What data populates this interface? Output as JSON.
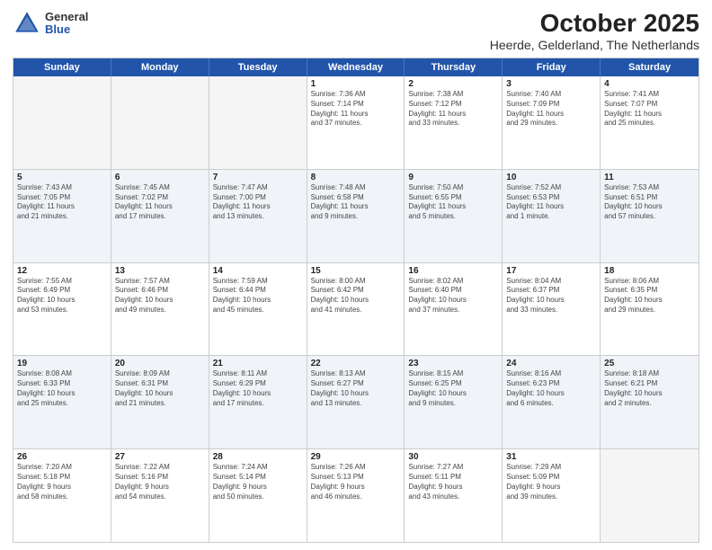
{
  "header": {
    "logo": {
      "general": "General",
      "blue": "Blue"
    },
    "title": "October 2025",
    "subtitle": "Heerde, Gelderland, The Netherlands"
  },
  "weekdays": [
    "Sunday",
    "Monday",
    "Tuesday",
    "Wednesday",
    "Thursday",
    "Friday",
    "Saturday"
  ],
  "weeks": [
    [
      {
        "day": "",
        "info": ""
      },
      {
        "day": "",
        "info": ""
      },
      {
        "day": "",
        "info": ""
      },
      {
        "day": "1",
        "info": "Sunrise: 7:36 AM\nSunset: 7:14 PM\nDaylight: 11 hours\nand 37 minutes."
      },
      {
        "day": "2",
        "info": "Sunrise: 7:38 AM\nSunset: 7:12 PM\nDaylight: 11 hours\nand 33 minutes."
      },
      {
        "day": "3",
        "info": "Sunrise: 7:40 AM\nSunset: 7:09 PM\nDaylight: 11 hours\nand 29 minutes."
      },
      {
        "day": "4",
        "info": "Sunrise: 7:41 AM\nSunset: 7:07 PM\nDaylight: 11 hours\nand 25 minutes."
      }
    ],
    [
      {
        "day": "5",
        "info": "Sunrise: 7:43 AM\nSunset: 7:05 PM\nDaylight: 11 hours\nand 21 minutes."
      },
      {
        "day": "6",
        "info": "Sunrise: 7:45 AM\nSunset: 7:02 PM\nDaylight: 11 hours\nand 17 minutes."
      },
      {
        "day": "7",
        "info": "Sunrise: 7:47 AM\nSunset: 7:00 PM\nDaylight: 11 hours\nand 13 minutes."
      },
      {
        "day": "8",
        "info": "Sunrise: 7:48 AM\nSunset: 6:58 PM\nDaylight: 11 hours\nand 9 minutes."
      },
      {
        "day": "9",
        "info": "Sunrise: 7:50 AM\nSunset: 6:55 PM\nDaylight: 11 hours\nand 5 minutes."
      },
      {
        "day": "10",
        "info": "Sunrise: 7:52 AM\nSunset: 6:53 PM\nDaylight: 11 hours\nand 1 minute."
      },
      {
        "day": "11",
        "info": "Sunrise: 7:53 AM\nSunset: 6:51 PM\nDaylight: 10 hours\nand 57 minutes."
      }
    ],
    [
      {
        "day": "12",
        "info": "Sunrise: 7:55 AM\nSunset: 6:49 PM\nDaylight: 10 hours\nand 53 minutes."
      },
      {
        "day": "13",
        "info": "Sunrise: 7:57 AM\nSunset: 6:46 PM\nDaylight: 10 hours\nand 49 minutes."
      },
      {
        "day": "14",
        "info": "Sunrise: 7:59 AM\nSunset: 6:44 PM\nDaylight: 10 hours\nand 45 minutes."
      },
      {
        "day": "15",
        "info": "Sunrise: 8:00 AM\nSunset: 6:42 PM\nDaylight: 10 hours\nand 41 minutes."
      },
      {
        "day": "16",
        "info": "Sunrise: 8:02 AM\nSunset: 6:40 PM\nDaylight: 10 hours\nand 37 minutes."
      },
      {
        "day": "17",
        "info": "Sunrise: 8:04 AM\nSunset: 6:37 PM\nDaylight: 10 hours\nand 33 minutes."
      },
      {
        "day": "18",
        "info": "Sunrise: 8:06 AM\nSunset: 6:35 PM\nDaylight: 10 hours\nand 29 minutes."
      }
    ],
    [
      {
        "day": "19",
        "info": "Sunrise: 8:08 AM\nSunset: 6:33 PM\nDaylight: 10 hours\nand 25 minutes."
      },
      {
        "day": "20",
        "info": "Sunrise: 8:09 AM\nSunset: 6:31 PM\nDaylight: 10 hours\nand 21 minutes."
      },
      {
        "day": "21",
        "info": "Sunrise: 8:11 AM\nSunset: 6:29 PM\nDaylight: 10 hours\nand 17 minutes."
      },
      {
        "day": "22",
        "info": "Sunrise: 8:13 AM\nSunset: 6:27 PM\nDaylight: 10 hours\nand 13 minutes."
      },
      {
        "day": "23",
        "info": "Sunrise: 8:15 AM\nSunset: 6:25 PM\nDaylight: 10 hours\nand 9 minutes."
      },
      {
        "day": "24",
        "info": "Sunrise: 8:16 AM\nSunset: 6:23 PM\nDaylight: 10 hours\nand 6 minutes."
      },
      {
        "day": "25",
        "info": "Sunrise: 8:18 AM\nSunset: 6:21 PM\nDaylight: 10 hours\nand 2 minutes."
      }
    ],
    [
      {
        "day": "26",
        "info": "Sunrise: 7:20 AM\nSunset: 5:18 PM\nDaylight: 9 hours\nand 58 minutes."
      },
      {
        "day": "27",
        "info": "Sunrise: 7:22 AM\nSunset: 5:16 PM\nDaylight: 9 hours\nand 54 minutes."
      },
      {
        "day": "28",
        "info": "Sunrise: 7:24 AM\nSunset: 5:14 PM\nDaylight: 9 hours\nand 50 minutes."
      },
      {
        "day": "29",
        "info": "Sunrise: 7:26 AM\nSunset: 5:13 PM\nDaylight: 9 hours\nand 46 minutes."
      },
      {
        "day": "30",
        "info": "Sunrise: 7:27 AM\nSunset: 5:11 PM\nDaylight: 9 hours\nand 43 minutes."
      },
      {
        "day": "31",
        "info": "Sunrise: 7:29 AM\nSunset: 5:09 PM\nDaylight: 9 hours\nand 39 minutes."
      },
      {
        "day": "",
        "info": ""
      }
    ]
  ]
}
